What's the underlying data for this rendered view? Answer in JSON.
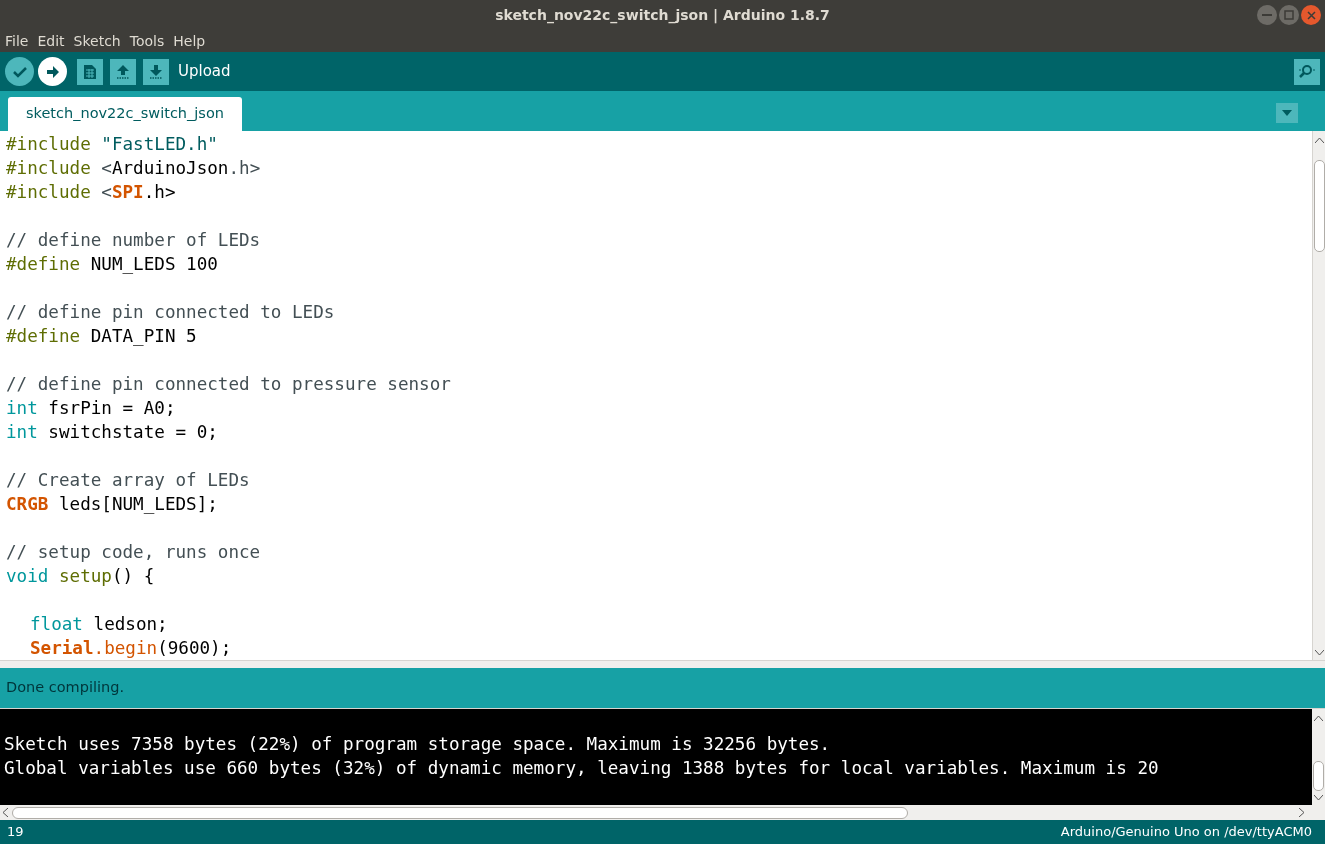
{
  "window": {
    "title": "sketch_nov22c_switch_json | Arduino 1.8.7"
  },
  "menu": [
    "File",
    "Edit",
    "Sketch",
    "Tools",
    "Help"
  ],
  "toolbar": {
    "buttons": [
      {
        "kind": "verify",
        "selected": false
      },
      {
        "kind": "upload",
        "selected": true
      },
      {
        "kind": "new",
        "selected": false
      },
      {
        "kind": "open",
        "selected": false
      },
      {
        "kind": "save",
        "selected": false
      }
    ],
    "hint": "Upload"
  },
  "tabs": [
    {
      "label": "sketch_nov22c_switch_json",
      "selected": true
    }
  ],
  "editor": {
    "blocks": [
      [
        {
          "tokens": [
            {
              "text": "#include",
              "kind": "directive"
            },
            {
              "text": " \"FastLED.h\"",
              "kind": "string"
            }
          ]
        },
        {
          "tokens": [
            {
              "text": "#include",
              "kind": "directive"
            },
            {
              "text": " <",
              "kind": "punct"
            },
            {
              "text": "ArduinoJson",
              "kind": "plain"
            },
            {
              "text": ".h>",
              "kind": "punct"
            }
          ]
        },
        {
          "tokens": [
            {
              "text": "#include",
              "kind": "directive"
            },
            {
              "text": " <",
              "kind": "punct"
            },
            {
              "text": "SPI",
              "kind": "class"
            },
            {
              "text": ".h>",
              "kind": "plain"
            }
          ]
        }
      ],
      [
        {
          "tokens": [
            {
              "text": "// define number of LEDs",
              "kind": "comment"
            }
          ]
        },
        {
          "tokens": [
            {
              "text": "#define",
              "kind": "directive"
            },
            {
              "text": " NUM_LEDS 100",
              "kind": "plain"
            }
          ]
        }
      ],
      [
        {
          "tokens": [
            {
              "text": "// define pin connected to LEDs",
              "kind": "comment"
            }
          ]
        },
        {
          "tokens": [
            {
              "text": "#define",
              "kind": "directive"
            },
            {
              "text": " DATA_PIN 5",
              "kind": "plain"
            }
          ]
        }
      ],
      [
        {
          "tokens": [
            {
              "text": "// define pin connected to pressure sensor",
              "kind": "comment"
            }
          ]
        },
        {
          "tokens": [
            {
              "text": "int",
              "kind": "type"
            },
            {
              "text": " fsrPin = A0;",
              "kind": "plain"
            }
          ]
        },
        {
          "tokens": [
            {
              "text": "int",
              "kind": "type"
            },
            {
              "text": " switchstate = 0;",
              "kind": "plain"
            }
          ]
        }
      ],
      [
        {
          "tokens": [
            {
              "text": "// Create array of LEDs",
              "kind": "comment"
            }
          ]
        },
        {
          "tokens": [
            {
              "text": "CRGB",
              "kind": "class"
            },
            {
              "text": " leds[NUM_LEDS];",
              "kind": "plain"
            }
          ]
        }
      ],
      [
        {
          "tokens": [
            {
              "text": "// setup code, runs once",
              "kind": "comment"
            }
          ]
        },
        {
          "tokens": [
            {
              "text": "void",
              "kind": "type"
            },
            {
              "text": " setup",
              "kind": "function"
            },
            {
              "text": "() {",
              "kind": "plain"
            }
          ],
          "children": [
            [
              {
                "tokens": [
                  {
                    "text": "float",
                    "kind": "type"
                  },
                  {
                    "text": " ledson;",
                    "kind": "plain"
                  }
                ]
              },
              {
                "tokens": [
                  {
                    "text": "Serial",
                    "kind": "class"
                  },
                  {
                    "text": ".begin",
                    "kind": "method"
                  },
                  {
                    "text": "(9600);",
                    "kind": "plain"
                  }
                ]
              }
            ]
          ]
        }
      ]
    ]
  },
  "status": "Done compiling.",
  "console": [
    "Sketch uses 7358 bytes (22%) of program storage space. Maximum is 32256 bytes.",
    "Global variables use 660 bytes (32%) of dynamic memory, leaving 1388 bytes for local variables. Maximum is 20"
  ],
  "footer": {
    "line": "19",
    "board": "Arduino/Genuino Uno on /dev/ttyACM0"
  }
}
